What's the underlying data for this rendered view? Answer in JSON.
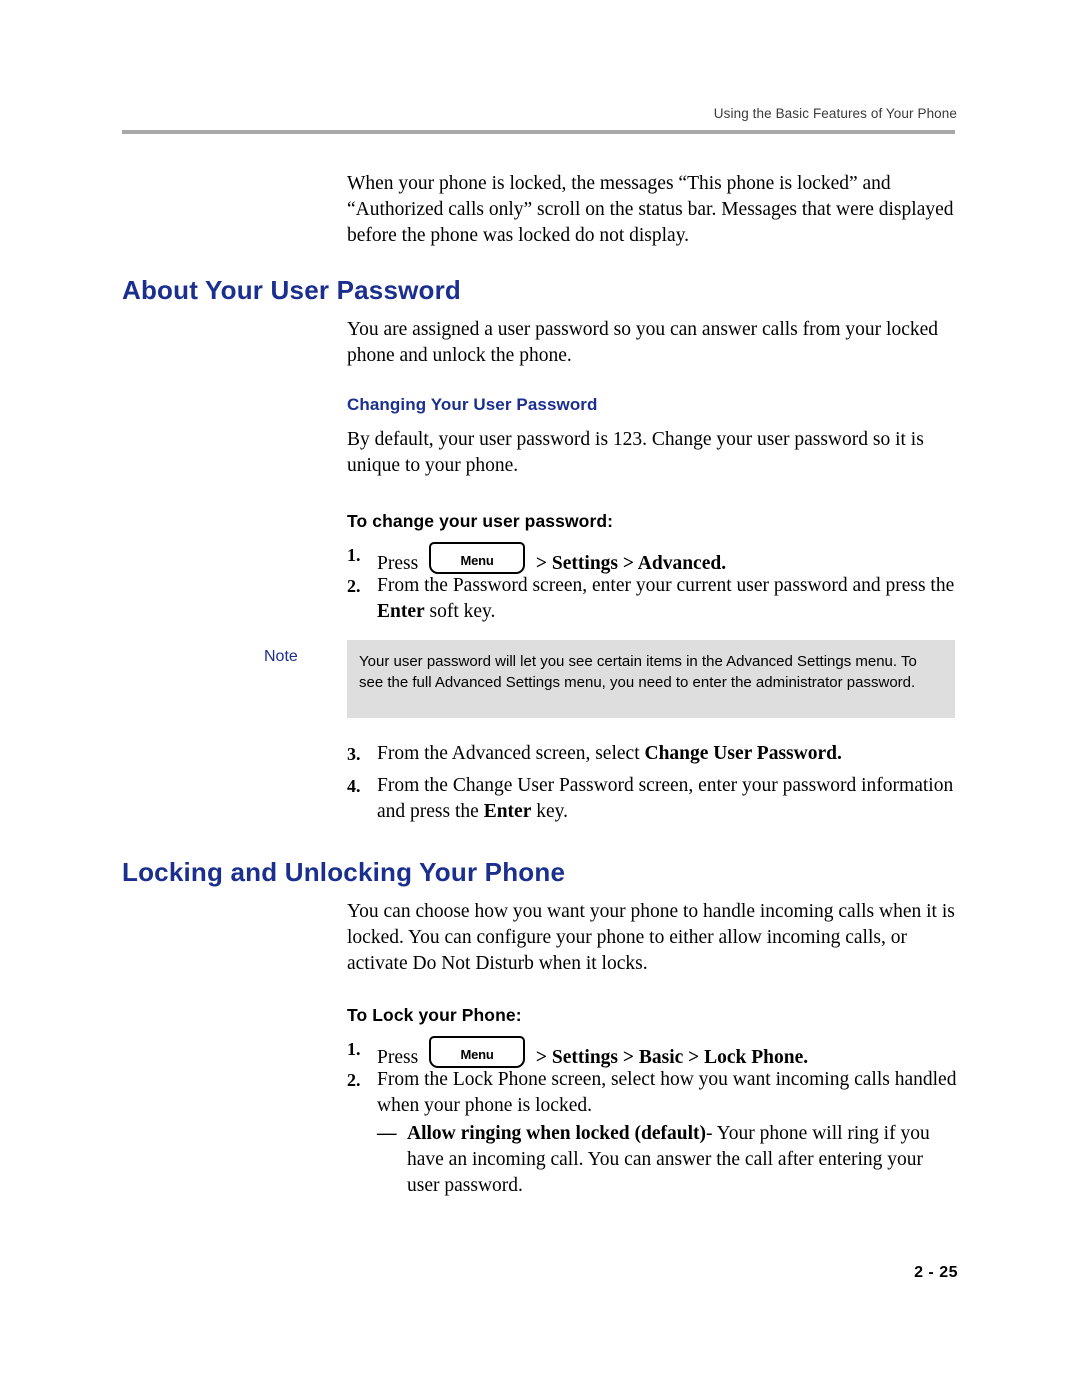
{
  "header": {
    "running_head": "Using the Basic Features of Your Phone"
  },
  "intro": {
    "paragraph": "When your phone is locked, the messages “This phone is locked” and “Authorized calls only” scroll on the status bar. Messages that were displayed before the phone was locked do not display."
  },
  "section_password": {
    "title": "About Your User Password",
    "intro": "You are assigned a user password so you can answer calls from your locked phone and unlock the phone.",
    "subsection_title": "Changing Your User Password",
    "subsection_intro": "By default, your user password is 123. Change your user password so it is unique to your phone.",
    "task_title": "To change your user password:",
    "step1_prefix": "Press",
    "step1_key": "Menu",
    "step1_suffix": "> Settings > Advanced.",
    "step1_num": "1.",
    "step2_num": "2.",
    "step2_a": "From the Password screen, enter your current user password and press the ",
    "step2_b": "Enter",
    "step2_c": " soft key.",
    "step3_num": "3.",
    "step3_a": "From the Advanced screen, select ",
    "step3_b": "Change User Password.",
    "step4_num": "4.",
    "step4_a": "From the Change User Password screen, enter your password information and press the ",
    "step4_b": "Enter",
    "step4_c": " key."
  },
  "note": {
    "label": "Note",
    "text": "Your user password will let you see certain items in the Advanced Settings menu. To see the full Advanced Settings menu, you need to enter the administrator password."
  },
  "section_lock": {
    "title": "Locking and Unlocking Your Phone",
    "intro": "You can choose how you want your phone to handle incoming calls when it is locked. You can configure your phone to either allow incoming calls, or activate Do Not Disturb when it locks.",
    "task_title": "To Lock your Phone:",
    "step1_num": "1.",
    "step1_prefix": "Press",
    "step1_key": "Menu",
    "step1_suffix": "> Settings > Basic > Lock Phone.",
    "step2_num": "2.",
    "step2_text": "From the Lock Phone screen, select how you want incoming calls handled when your phone is locked.",
    "bullet_dash": "—",
    "bullet_bold": "Allow ringing when locked (default)",
    "bullet_rest": "- Your phone will ring if you have an incoming call. You can answer the call after entering your user password."
  },
  "footer": {
    "page_number": "2 - 25"
  }
}
